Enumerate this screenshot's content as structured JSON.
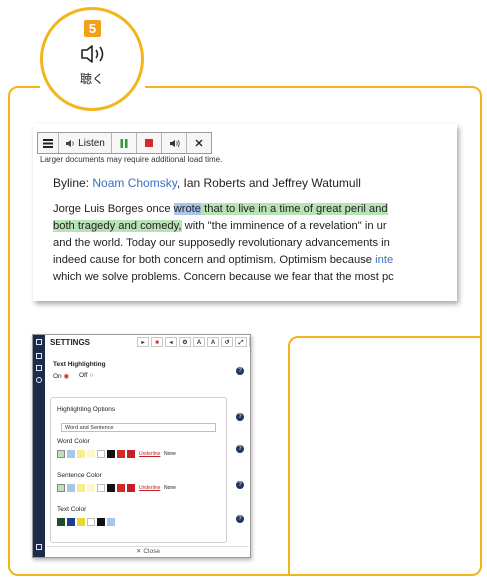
{
  "badge": {
    "number": "5",
    "label": "聴く"
  },
  "toolbar": {
    "listen_label": "Listen"
  },
  "note": "Larger documents may require additional load time.",
  "byline": {
    "prefix": "Byline: ",
    "author1": "Noam Chomsky",
    "rest": ", Ian Roberts and Jeffrey Watumull"
  },
  "body": {
    "line1_a": "Jorge Luis Borges once ",
    "line1_word": "wrote",
    "line1_b": " that to live in a time of great peril and",
    "line2_hl": "both tragedy and comedy,",
    "line2_rest": " with \"the imminence of a revelation\" in ur",
    "line3": "and the world. Today our supposedly revolutionary advancements in",
    "line4_a": "indeed cause for both concern and optimism. Optimism because ",
    "line4_link": "inte",
    "line5": "which we solve problems. Concern because we fear that the most pc"
  },
  "settings": {
    "title": "SETTINGS",
    "text_highlighting": "Text Highlighting",
    "on": "On",
    "off": "Off",
    "highlighting_options": "Highlighting Options",
    "select_value": "Word and Sentence",
    "word_color": "Word Color",
    "sentence_color": "Sentence Color",
    "text_color": "Text Color",
    "underline": "Underline",
    "none": "None",
    "close": "Close"
  },
  "colors": {
    "accent": "#f2b51a",
    "highlight_sentence": "#b9e3b6",
    "highlight_word": "#a9c5ea",
    "link": "#3a6fc4",
    "settings_rail": "#1c2b4a"
  }
}
